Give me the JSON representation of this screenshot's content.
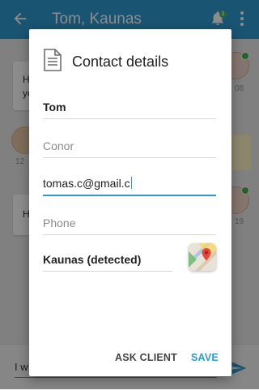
{
  "appbar": {
    "title": "Tom, Kaunas",
    "notification_count": "3",
    "icons": {
      "back": "arrow-left-icon",
      "bell": "bell-icon",
      "more": "more-vert-icon"
    }
  },
  "background": {
    "messages": [
      {
        "text": "H",
        "text2": "yo",
        "time": "08"
      },
      {
        "text": "",
        "time": "12"
      },
      {
        "text": "H",
        "time": "19"
      }
    ],
    "composer_text": "I w"
  },
  "dialog": {
    "title": "Contact details",
    "icon": "document-icon",
    "fields": {
      "first_name": {
        "value": "Tom"
      },
      "last_name": {
        "placeholder": "Conor"
      },
      "email": {
        "value": "tomas.c@gmail.c"
      },
      "phone": {
        "placeholder": "Phone"
      },
      "location": {
        "value": "Kaunas (detected)"
      }
    },
    "maps_icon": "google-maps-icon",
    "buttons": {
      "ask_client": "ASK CLIENT",
      "save": "SAVE"
    }
  },
  "colors": {
    "accent": "#2f9ad1",
    "online": "#4caf50",
    "badge": "#3fbf5a"
  }
}
